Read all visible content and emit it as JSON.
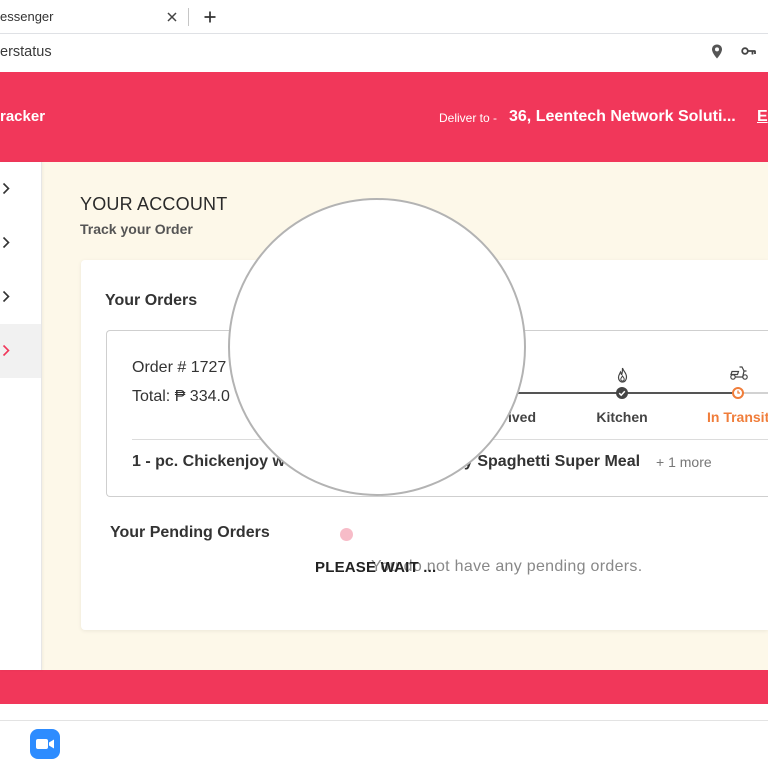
{
  "browser": {
    "tab": {
      "title": "essenger",
      "close_icon": "close-icon"
    },
    "new_tab_icon": "plus-icon",
    "address": "erstatus",
    "address_icons": [
      "location-pin-icon",
      "key-icon"
    ]
  },
  "header": {
    "brand": "racker",
    "deliver_label": "Deliver to -",
    "address": "36, Leentech Network Soluti...",
    "edit_link": "E"
  },
  "sidebar": {
    "items": [
      {
        "icon": "chevron-right-icon",
        "active": false
      },
      {
        "icon": "chevron-right-icon",
        "active": false
      },
      {
        "icon": "chevron-right-icon",
        "active": false
      },
      {
        "icon": "chevron-right-icon",
        "active": true
      }
    ]
  },
  "account": {
    "title": "YOUR ACCOUNT",
    "subtitle": "Track your Order"
  },
  "orders": {
    "title": "Your Orders",
    "order": {
      "number": "Order # 1727",
      "total": "Total: ₱ 334.0",
      "steps": [
        {
          "label": "ived",
          "completed": true,
          "current": false
        },
        {
          "label": "Kitchen",
          "completed": true,
          "current": false,
          "icon": "flame-icon"
        },
        {
          "label": "In Transit",
          "completed": false,
          "current": true,
          "icon": "scooter-icon"
        }
      ],
      "items_summary_start": "1 - pc. Chickenjoy w",
      "items_summary_end": "y Spaghetti Super Meal",
      "more": "+ 1 more"
    }
  },
  "pending": {
    "title": "Your Pending Orders",
    "empty_message": "You do not have any pending orders."
  },
  "loading": {
    "message": "PLEASE WAIT ...",
    "spinner_icon": "loading-dot-icon"
  },
  "taskbar": {
    "apps": [
      {
        "icon": "zoom-icon"
      }
    ]
  },
  "colors": {
    "brand_red": "#f1375a",
    "page_background": "#fdf8e9",
    "accent_orange": "#f07d3a",
    "zoom_blue": "#2d8cff"
  }
}
